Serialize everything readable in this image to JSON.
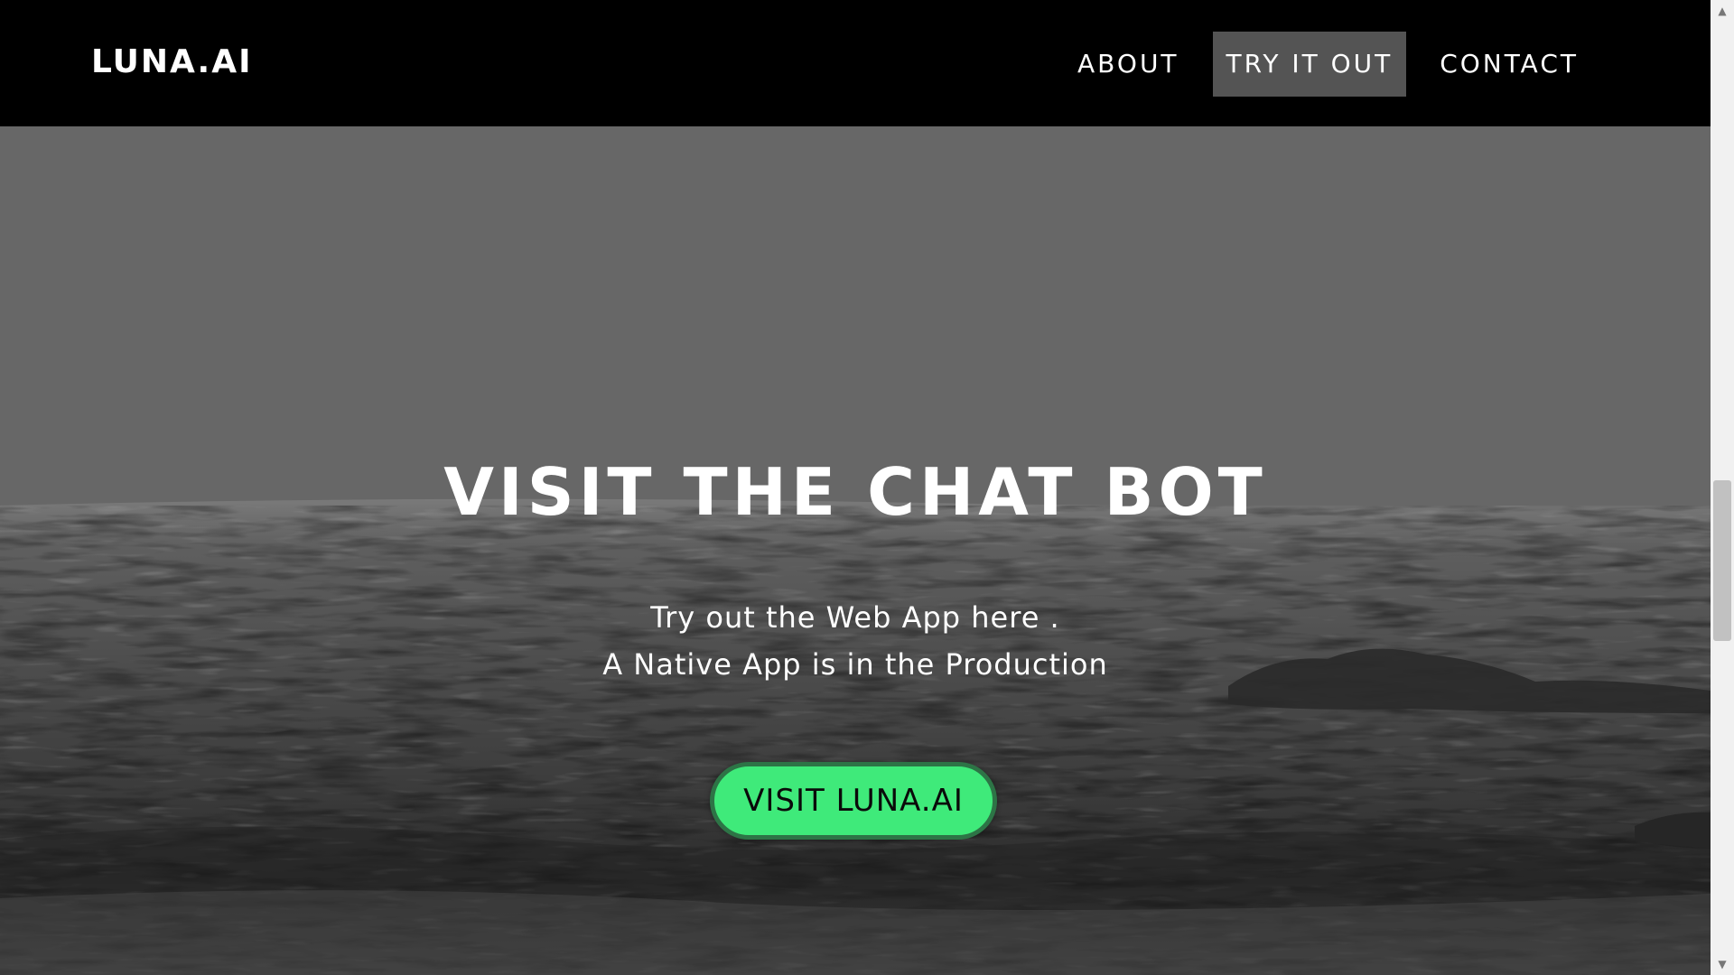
{
  "nav": {
    "brand": "LUNA.AI",
    "links": [
      {
        "label": "ABOUT",
        "active": false
      },
      {
        "label": "TRY IT OUT",
        "active": true
      },
      {
        "label": "CONTACT",
        "active": false
      }
    ]
  },
  "hero": {
    "title": "VISIT THE CHAT BOT",
    "subtitle_line1": "Try out the Web App here .",
    "subtitle_line2": "A Native App is in the Production",
    "cta_label": "VISIT LUNA.AI"
  },
  "colors": {
    "navbar_bg": "#000000",
    "active_tab_bg": "#545454",
    "cta_bg": "#3fea7a",
    "cta_border": "#2d7446",
    "text": "#ffffff"
  },
  "icons": {
    "scroll_up": "chevron-up-icon",
    "scroll_down": "chevron-down-icon"
  }
}
